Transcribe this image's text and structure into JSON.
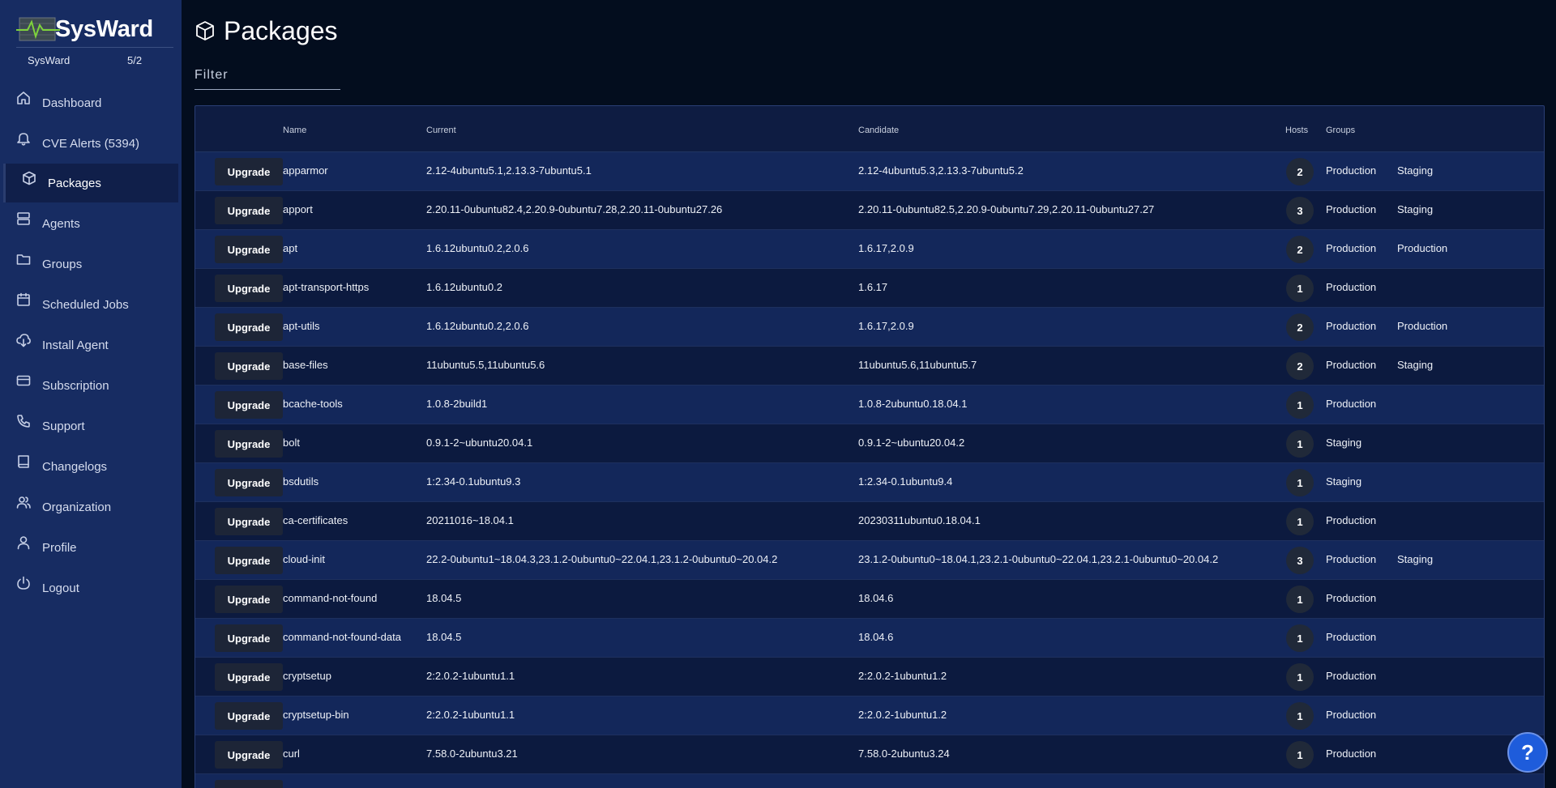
{
  "app": {
    "name": "SysWard",
    "org": "SysWard",
    "org_count": "5/2"
  },
  "sidebar": {
    "items": [
      {
        "label": "Dashboard",
        "icon": "home-icon"
      },
      {
        "label": "CVE Alerts (5394)",
        "icon": "bell-icon"
      },
      {
        "label": "Packages",
        "icon": "package-icon",
        "active": true
      },
      {
        "label": "Agents",
        "icon": "server-icon"
      },
      {
        "label": "Groups",
        "icon": "folder-icon"
      },
      {
        "label": "Scheduled Jobs",
        "icon": "calendar-icon"
      },
      {
        "label": "Install Agent",
        "icon": "cloud-download-icon"
      },
      {
        "label": "Subscription",
        "icon": "credit-card-icon"
      },
      {
        "label": "Support",
        "icon": "phone-icon"
      },
      {
        "label": "Changelogs",
        "icon": "book-icon"
      },
      {
        "label": "Organization",
        "icon": "users-icon"
      },
      {
        "label": "Profile",
        "icon": "user-icon"
      },
      {
        "label": "Logout",
        "icon": "power-icon"
      }
    ]
  },
  "header": {
    "title": "Packages",
    "icon": "package-icon"
  },
  "filter": {
    "label": "Filter"
  },
  "table": {
    "columns": {
      "name": "Name",
      "current": "Current",
      "candidate": "Candidate",
      "hosts": "Hosts",
      "groups": "Groups"
    },
    "action_label": "Upgrade",
    "rows": [
      {
        "name": "apparmor",
        "current": "2.12-4ubuntu5.1,2.13.3-7ubuntu5.1",
        "candidate": "2.12-4ubuntu5.3,2.13.3-7ubuntu5.2",
        "hosts": "2",
        "groups": [
          "Production",
          "Staging"
        ]
      },
      {
        "name": "apport",
        "current": "2.20.11-0ubuntu82.4,2.20.9-0ubuntu7.28,2.20.11-0ubuntu27.26",
        "candidate": "2.20.11-0ubuntu82.5,2.20.9-0ubuntu7.29,2.20.11-0ubuntu27.27",
        "hosts": "3",
        "groups": [
          "Production",
          "Staging"
        ]
      },
      {
        "name": "apt",
        "current": "1.6.12ubuntu0.2,2.0.6",
        "candidate": "1.6.17,2.0.9",
        "hosts": "2",
        "groups": [
          "Production",
          "Production"
        ]
      },
      {
        "name": "apt-transport-https",
        "current": "1.6.12ubuntu0.2",
        "candidate": "1.6.17",
        "hosts": "1",
        "groups": [
          "Production"
        ]
      },
      {
        "name": "apt-utils",
        "current": "1.6.12ubuntu0.2,2.0.6",
        "candidate": "1.6.17,2.0.9",
        "hosts": "2",
        "groups": [
          "Production",
          "Production"
        ]
      },
      {
        "name": "base-files",
        "current": "11ubuntu5.5,11ubuntu5.6",
        "candidate": "11ubuntu5.6,11ubuntu5.7",
        "hosts": "2",
        "groups": [
          "Production",
          "Staging"
        ]
      },
      {
        "name": "bcache-tools",
        "current": "1.0.8-2build1",
        "candidate": "1.0.8-2ubuntu0.18.04.1",
        "hosts": "1",
        "groups": [
          "Production"
        ]
      },
      {
        "name": "bolt",
        "current": "0.9.1-2~ubuntu20.04.1",
        "candidate": "0.9.1-2~ubuntu20.04.2",
        "hosts": "1",
        "groups": [
          "Staging"
        ]
      },
      {
        "name": "bsdutils",
        "current": "1:2.34-0.1ubuntu9.3",
        "candidate": "1:2.34-0.1ubuntu9.4",
        "hosts": "1",
        "groups": [
          "Staging"
        ]
      },
      {
        "name": "ca-certificates",
        "current": "20211016~18.04.1",
        "candidate": "20230311ubuntu0.18.04.1",
        "hosts": "1",
        "groups": [
          "Production"
        ]
      },
      {
        "name": "cloud-init",
        "current": "22.2-0ubuntu1~18.04.3,23.1.2-0ubuntu0~22.04.1,23.1.2-0ubuntu0~20.04.2",
        "candidate": "23.1.2-0ubuntu0~18.04.1,23.2.1-0ubuntu0~22.04.1,23.2.1-0ubuntu0~20.04.2",
        "hosts": "3",
        "groups": [
          "Production",
          "Staging"
        ]
      },
      {
        "name": "command-not-found",
        "current": "18.04.5",
        "candidate": "18.04.6",
        "hosts": "1",
        "groups": [
          "Production"
        ]
      },
      {
        "name": "command-not-found-data",
        "current": "18.04.5",
        "candidate": "18.04.6",
        "hosts": "1",
        "groups": [
          "Production"
        ]
      },
      {
        "name": "cryptsetup",
        "current": "2:2.0.2-1ubuntu1.1",
        "candidate": "2:2.0.2-1ubuntu1.2",
        "hosts": "1",
        "groups": [
          "Production"
        ]
      },
      {
        "name": "cryptsetup-bin",
        "current": "2:2.0.2-1ubuntu1.1",
        "candidate": "2:2.0.2-1ubuntu1.2",
        "hosts": "1",
        "groups": [
          "Production"
        ]
      },
      {
        "name": "curl",
        "current": "7.58.0-2ubuntu3.21",
        "candidate": "7.58.0-2ubuntu3.24",
        "hosts": "1",
        "groups": [
          "Production"
        ]
      },
      {
        "name": "",
        "current": "",
        "candidate": "",
        "hosts": "",
        "groups": []
      }
    ]
  },
  "help": {
    "label": "?"
  },
  "colors": {
    "sidebar": "#172c62",
    "background": "#030d1e",
    "row_odd": "#13275a",
    "row_even": "#0c1a3f",
    "help": "#1e5cdb"
  }
}
